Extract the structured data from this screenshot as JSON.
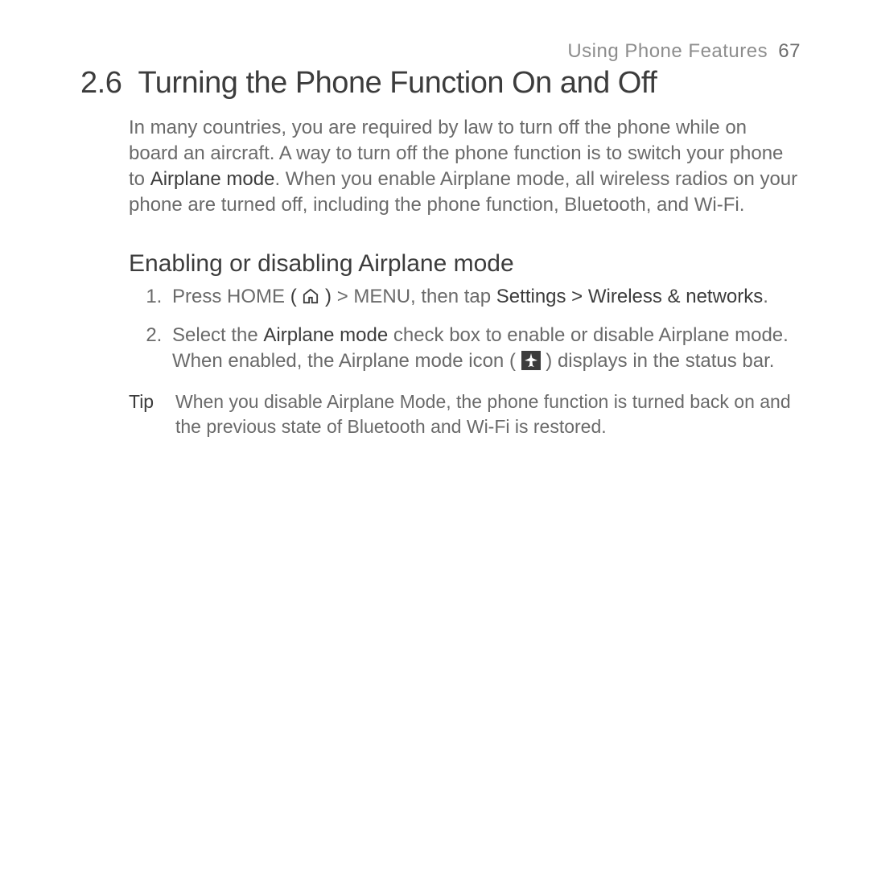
{
  "header": {
    "chapter": "Using Phone Features",
    "page": "67"
  },
  "section": {
    "number": "2.6",
    "title": "Turning the Phone Function On and Off"
  },
  "intro": {
    "pre": "In many countries, you are required by law to turn off the phone while on board an aircraft. A way to turn off the phone function is to switch your phone to ",
    "bold1": "Airplane mode",
    "post": ". When you enable Airplane mode, all wireless radios on your phone are turned off, including the phone function, Bluetooth, and Wi-Fi."
  },
  "subheading": "Enabling or disabling Airplane mode",
  "steps": {
    "s1_a": "Press HOME ",
    "s1_b": " > MENU, then tap ",
    "s1_bold": "Settings > Wireless & networks",
    "s1_c": ".",
    "s2_a": "Select the ",
    "s2_bold": "Airplane mode",
    "s2_b": " check box to enable or disable Airplane mode. When enabled, the Airplane mode icon ( ",
    "s2_c": " ) displays in the status bar."
  },
  "tip": {
    "label": "Tip",
    "body": "When you disable Airplane Mode, the phone function is turned back on and the previous state of Bluetooth and Wi-Fi is restored."
  }
}
